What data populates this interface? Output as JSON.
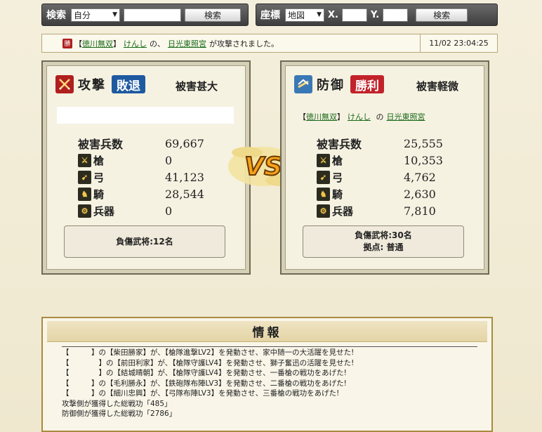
{
  "search": {
    "label": "検索",
    "select_value": "自分",
    "input_value": "",
    "button_label": "検索"
  },
  "coords": {
    "label": "座標",
    "select_value": "地図",
    "x_label": "X.",
    "x_value": "",
    "y_label": "Y.",
    "y_value": "",
    "button_label": "検索"
  },
  "message": {
    "badge": "勝",
    "open_bracket": "【",
    "alliance": "徳川無双",
    "close_bracket": "】",
    "player": "けんし",
    "of": "の、",
    "base": "日光東照宮",
    "text": "が攻撃されました。",
    "time": "11/02 23:04:25"
  },
  "attack": {
    "icon": "crossed-swords-icon",
    "title": "攻撃",
    "result": "敗退",
    "result_color": "#1e5aa0",
    "damage_level": "被害甚大",
    "name_line": "",
    "total_label": "被害兵数",
    "total_value": "69,667",
    "units": [
      {
        "label": "槍",
        "value": "0",
        "icon": "spear-icon"
      },
      {
        "label": "弓",
        "value": "41,123",
        "icon": "bow-icon"
      },
      {
        "label": "騎",
        "value": "28,544",
        "icon": "horse-icon"
      },
      {
        "label": "兵器",
        "value": "0",
        "icon": "siege-weapon-icon"
      }
    ],
    "injured": "負傷武将:12名",
    "base_type": ""
  },
  "defense": {
    "icon": "shield-castle-icon",
    "title": "防御",
    "result": "勝利",
    "result_color": "#c2232a",
    "damage_level": "被害軽微",
    "name_open": "【",
    "name_alliance": "徳川無双",
    "name_close": "】",
    "name_player": "けんし",
    "name_of": "の",
    "name_base": "日光東照宮",
    "total_label": "被害兵数",
    "total_value": "25,555",
    "units": [
      {
        "label": "槍",
        "value": "10,353",
        "icon": "spear-icon"
      },
      {
        "label": "弓",
        "value": "4,762",
        "icon": "bow-icon"
      },
      {
        "label": "騎",
        "value": "2,630",
        "icon": "horse-icon"
      },
      {
        "label": "兵器",
        "value": "7,810",
        "icon": "siege-weapon-icon"
      }
    ],
    "injured": "負傷武将:30名",
    "base_type": "拠点: 普通"
  },
  "vs": "VS",
  "info": {
    "title": "情報",
    "lines": [
      "【　　　】の【柴田勝家】が、【槍隊進撃LV2】を発動させ、家中随一の大活躍を見せた!",
      "【　　　　】の【前田利家】が、【槍隊守護LV4】を発動させ、獅子奮迅の活躍を見せた!",
      "【　　　　】の【結城晴朝】が、【槍隊守護LV4】を発動させ、一番槍の戦功をあげた!",
      "【　　　】の【毛利勝永】が、【鉄砲隊布陣LV3】を発動させ、二番槍の戦功をあげた!",
      "【　　　】の【細川忠興】が、【弓隊布陣LV3】を発動させ、三番槍の戦功をあげた!",
      "攻撃側が獲得した総戦功「485」",
      "防御側が獲得した総戦功「2786」"
    ]
  }
}
